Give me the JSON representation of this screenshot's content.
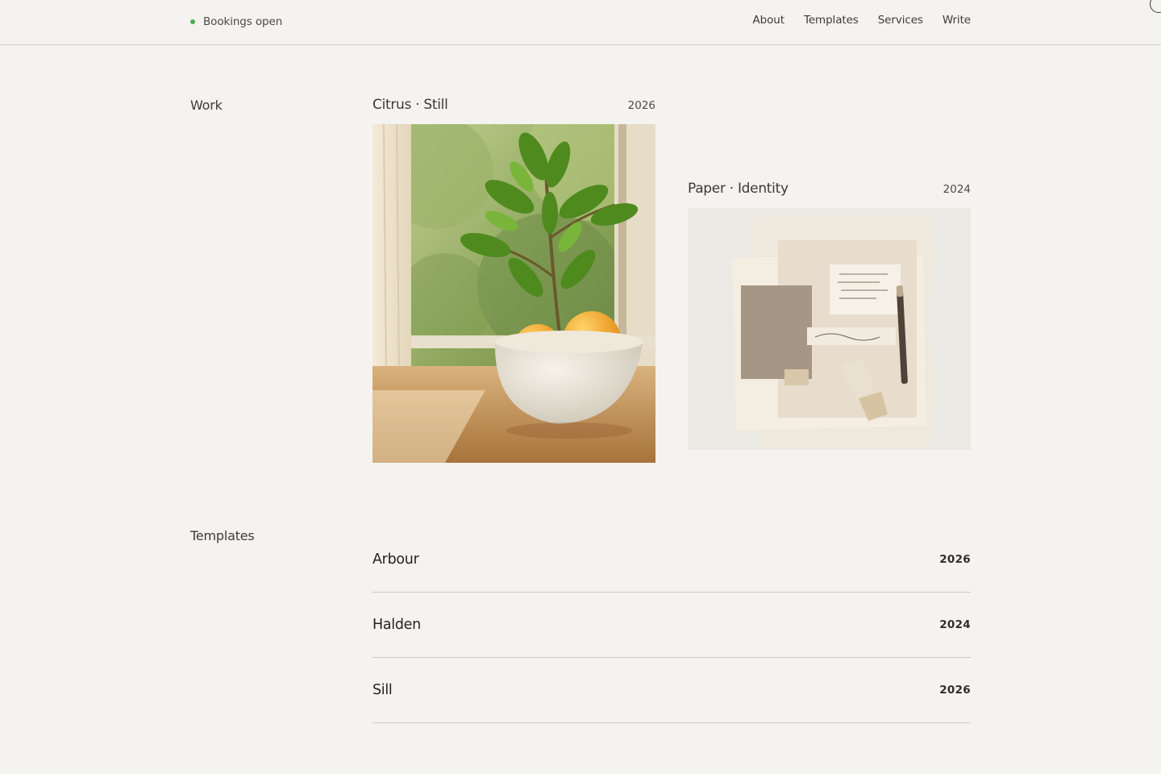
{
  "header": {
    "status_label": "Bookings open",
    "status_color": "#4caf50",
    "nav": [
      {
        "label": "About"
      },
      {
        "label": "Templates"
      },
      {
        "label": "Services"
      },
      {
        "label": "Write"
      }
    ]
  },
  "work": {
    "section_label": "Work",
    "cards": [
      {
        "title": "Citrus · Still",
        "year": "2026",
        "image": "photo of a potted citrus plant in a speckled ceramic bowl with oranges by a sunny window"
      },
      {
        "title": "Paper · Identity",
        "year": "2024",
        "image": "flat lay of torn handmade paper, linen swatches, handwritten notes and a pen"
      }
    ]
  },
  "templates": {
    "section_label": "Templates",
    "items": [
      {
        "name": "Arbour",
        "year": "2026"
      },
      {
        "name": "Halden",
        "year": "2024"
      },
      {
        "name": "Sill",
        "year": "2026"
      }
    ]
  }
}
